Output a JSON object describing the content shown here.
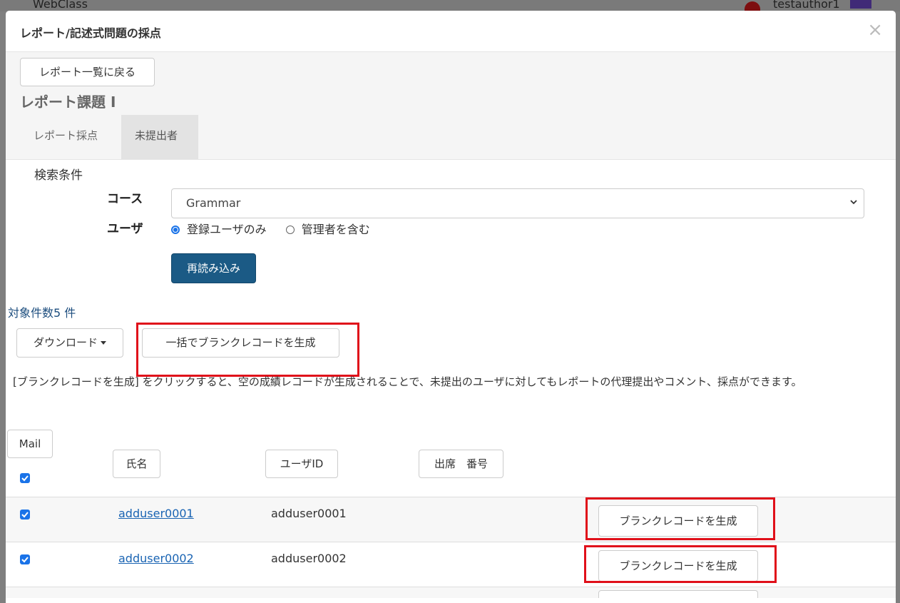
{
  "background": {
    "app_name": "WebClass",
    "username": "testauthor1"
  },
  "modal": {
    "title": "レポート/記述式問題の採点",
    "close_label": "×"
  },
  "top": {
    "back_label": "レポート一覧に戻る",
    "report_title": "レポート課題 I",
    "tabs": [
      {
        "label": "レポート採点",
        "active": false
      },
      {
        "label": "未提出者",
        "active": true
      }
    ]
  },
  "search": {
    "title": "検索条件",
    "course_label": "コース",
    "course_value": "Grammar",
    "user_label": "ユーザ",
    "user_options": [
      {
        "label": "登録ユーザのみ",
        "selected": true
      },
      {
        "label": "管理者を含む",
        "selected": false
      }
    ],
    "reload_label": "再読み込み"
  },
  "results": {
    "count_text": "対象件数5 件",
    "download_label": "ダウンロード",
    "bulk_label": "一括でブランクレコードを生成",
    "description": "[ブランクレコードを生成] をクリックすると、空の成績レコードが生成されることで、未提出のユーザに対してもレポートの代理提出やコメント、採点ができます。"
  },
  "table": {
    "mail_label": "Mail",
    "header_checked": true,
    "columns": [
      "氏名",
      "ユーザID",
      "出席　番号"
    ],
    "rows": [
      {
        "name": "adduser0001",
        "user_id": "adduser0001",
        "checked": true,
        "action": "ブランクレコードを生成"
      },
      {
        "name": "adduser0002",
        "user_id": "adduser0002",
        "checked": true,
        "action": "ブランクレコードを生成"
      }
    ]
  },
  "colors": {
    "primary": "#1b5a85",
    "link": "#1a64b3",
    "highlight": "#e0101a",
    "checkbox": "#1a73e8"
  }
}
